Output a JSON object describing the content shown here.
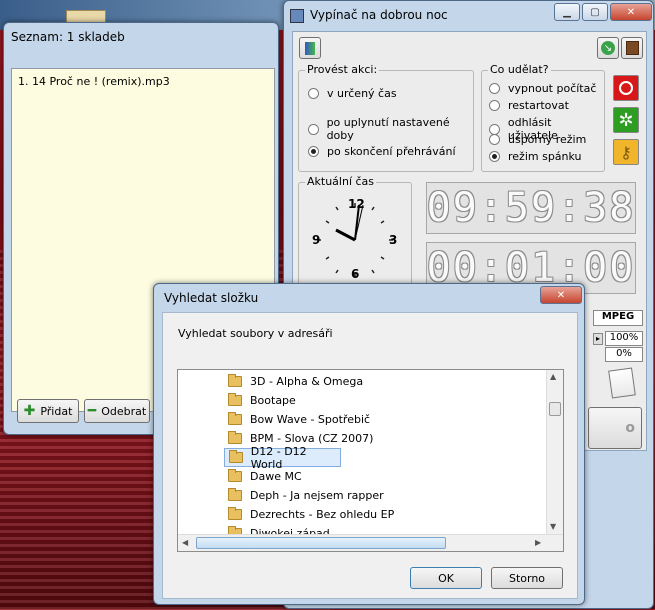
{
  "playlist": {
    "title": "Seznam: 1 skladeb",
    "items": [
      "1. 14 Proč ne ! (remix).mp3"
    ],
    "add_label": "Přidat",
    "remove_label": "Odebrat"
  },
  "main": {
    "title": "Vypínač na dobrou noc",
    "action_group": {
      "legend": "Provést akci:",
      "options": [
        "v určený čas",
        "po uplynutí nastavené doby",
        "po skončení přehrávání"
      ],
      "selected": 2
    },
    "what_group": {
      "legend": "Co udělat?",
      "options": [
        "vypnout počítač",
        "restartovat",
        "odhlásit uživatele",
        "úsporný režim",
        "režim spánku"
      ],
      "selected": 4
    },
    "clock": {
      "legend": "Aktuální čas",
      "numerals": [
        "12",
        "3",
        "6",
        "9"
      ]
    },
    "time_display": "09:59:38",
    "timer_display": "00:01:00",
    "format_label": "MPEG",
    "volume_top": "100%",
    "volume_bottom": "0%",
    "partial_button": "o",
    "colors": {
      "power": "#d81818",
      "green": "#2e9e22",
      "key": "#f0b52a"
    }
  },
  "dialog": {
    "title": "Vyhledat složku",
    "prompt": "Vyhledat soubory v adresáři",
    "folders": [
      "3D - Alpha & Omega",
      "Bootape",
      "Bow Wave - Spotřebič",
      "BPM - Slova (CZ 2007)",
      "D12 - D12 World",
      "Dawe MC",
      "Deph - Ja nejsem rapper",
      "Dezrechts - Bez ohledu EP",
      "Diwokej západ"
    ],
    "selected_index": 4,
    "ok_label": "OK",
    "cancel_label": "Storno"
  }
}
